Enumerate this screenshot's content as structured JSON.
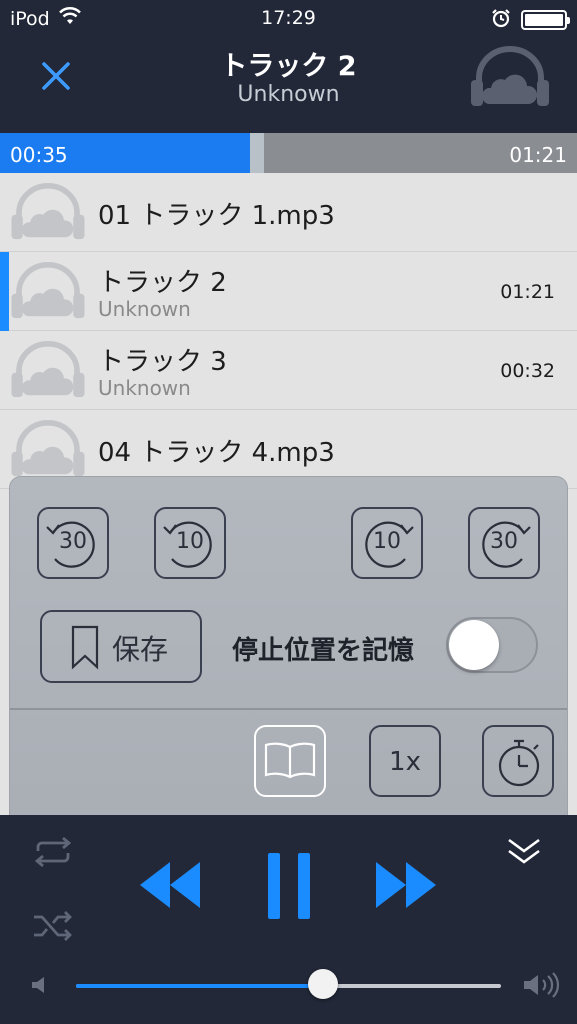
{
  "status": {
    "carrier": "iPod",
    "time": "17:29"
  },
  "header": {
    "title": "トラック 2",
    "subtitle": "Unknown"
  },
  "progress": {
    "elapsed": "00:35",
    "total": "01:21",
    "played_fraction": 0.434,
    "buffered_fraction": 0.459
  },
  "tracks": [
    {
      "name": "01 トラック 1.mp3",
      "artist": "",
      "duration": ""
    },
    {
      "name": "トラック 2",
      "artist": "Unknown",
      "duration": "01:21"
    },
    {
      "name": "トラック 3",
      "artist": "Unknown",
      "duration": "00:32"
    },
    {
      "name": "04 トラック 4.mp3",
      "artist": "",
      "duration": ""
    }
  ],
  "panel": {
    "skip_back_30": "30",
    "skip_back_10": "10",
    "skip_fwd_10": "10",
    "skip_fwd_30": "30",
    "save_label": "保存",
    "remember_label": "停止位置を記憶",
    "remember_on": false,
    "speed_label": "1x"
  },
  "player": {
    "volume_fraction": 0.58
  },
  "colors": {
    "accent": "#1a8cff",
    "header_bg": "#222838",
    "list_bg": "#e3e3e3",
    "panel_bg": "#b0b5bc"
  }
}
